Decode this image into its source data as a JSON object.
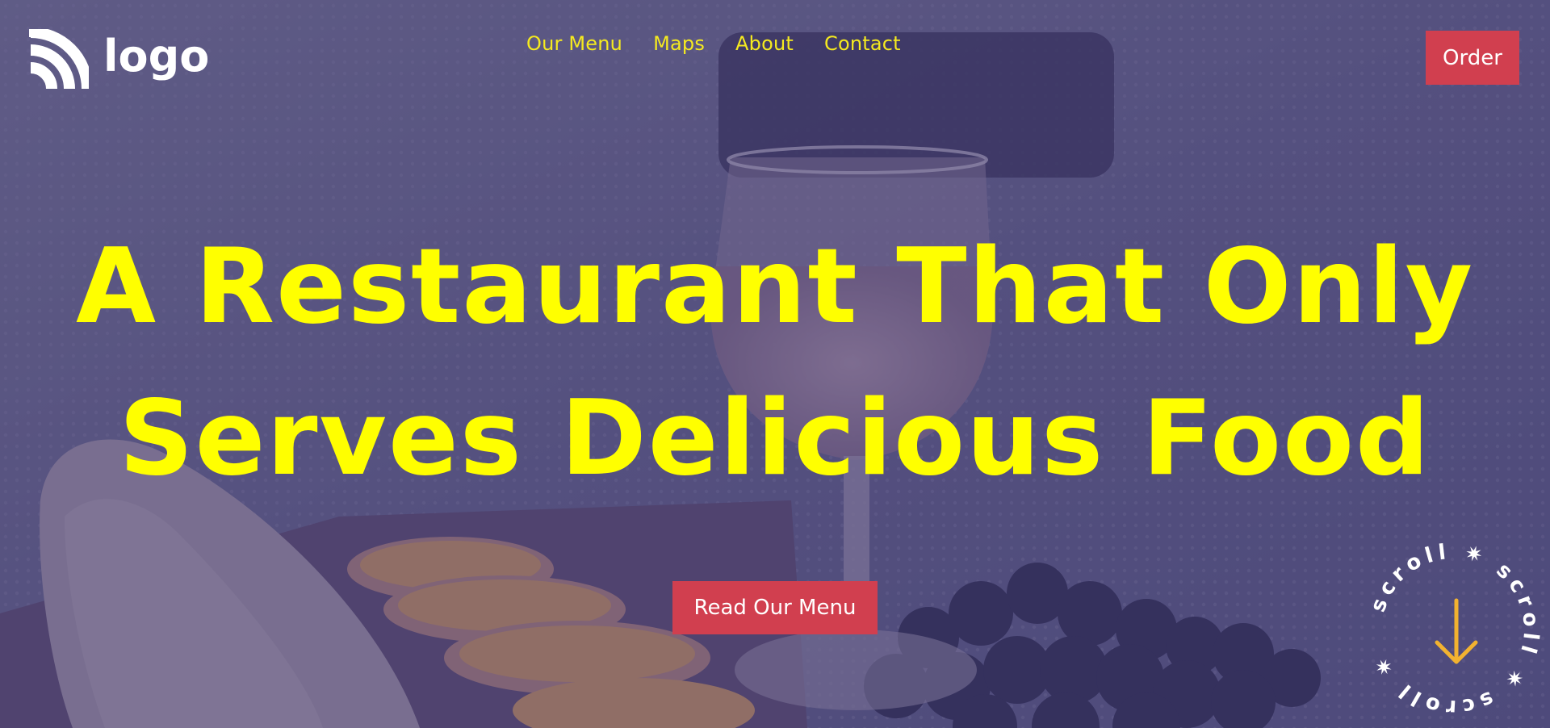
{
  "brand": {
    "logo_text": "logo",
    "logo_icon": "rainbow-arcs-icon"
  },
  "nav": {
    "items": [
      {
        "label": "Our Menu"
      },
      {
        "label": "Maps"
      },
      {
        "label": "About"
      },
      {
        "label": "Contact"
      }
    ]
  },
  "header": {
    "order_label": "Order"
  },
  "hero": {
    "headline_line1": "A Restaurant That Only",
    "headline_line2": "Serves Delicious Food",
    "cta_label": "Read Our Menu",
    "background_subject": "wine-glass-bread-oranges-grapes-photo"
  },
  "scroll_badge": {
    "text": "scroll",
    "icon": "arrow-down-icon"
  },
  "colors": {
    "overlay": "#4b4a7a",
    "nav_text": "#f5ea1f",
    "headline": "#ffff00",
    "button_bg": "#d13f4f",
    "button_text": "#ffffff",
    "arrow": "#f2b230"
  }
}
